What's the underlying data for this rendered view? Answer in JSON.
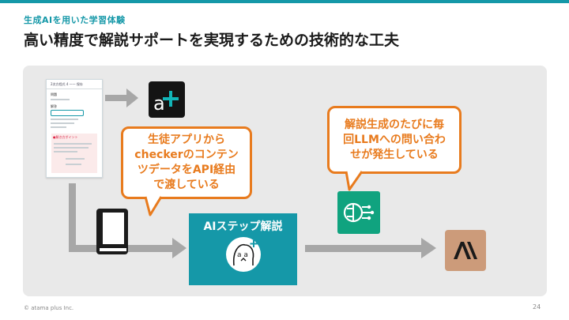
{
  "header": {
    "subtitle": "生成AIを用いた学習体験",
    "title": "高い精度で解説サポートを実現するための技術的な工夫"
  },
  "screenshot": {
    "header_text": "2次方程式 4 一一 保存",
    "label_problem": "問題",
    "label_answer": "解答",
    "label_point": "●解き方ポイント"
  },
  "bubbles": {
    "left": [
      "生徒アプリから",
      "checkerのコンテン",
      "ツデータをAPI経由",
      "で渡している"
    ],
    "right": [
      "解説生成のたびに毎",
      "回LLMへの問い合わ",
      "せが発生している"
    ]
  },
  "ai_box": {
    "label": "AIステップ解説"
  },
  "footer": {
    "copyright": "© atama plus Inc.",
    "page_number": "24"
  },
  "colors": {
    "accent": "#1598a8",
    "bubble": "#e87b1e",
    "panel": "#e9e9e9",
    "claude": "#cc9b7a",
    "openai": "#10a37f"
  },
  "icons": [
    "atama-plus-logo-icon",
    "book-icon",
    "ai-tutor-face-icon",
    "openai-logo-icon",
    "anthropic-logo-icon"
  ]
}
